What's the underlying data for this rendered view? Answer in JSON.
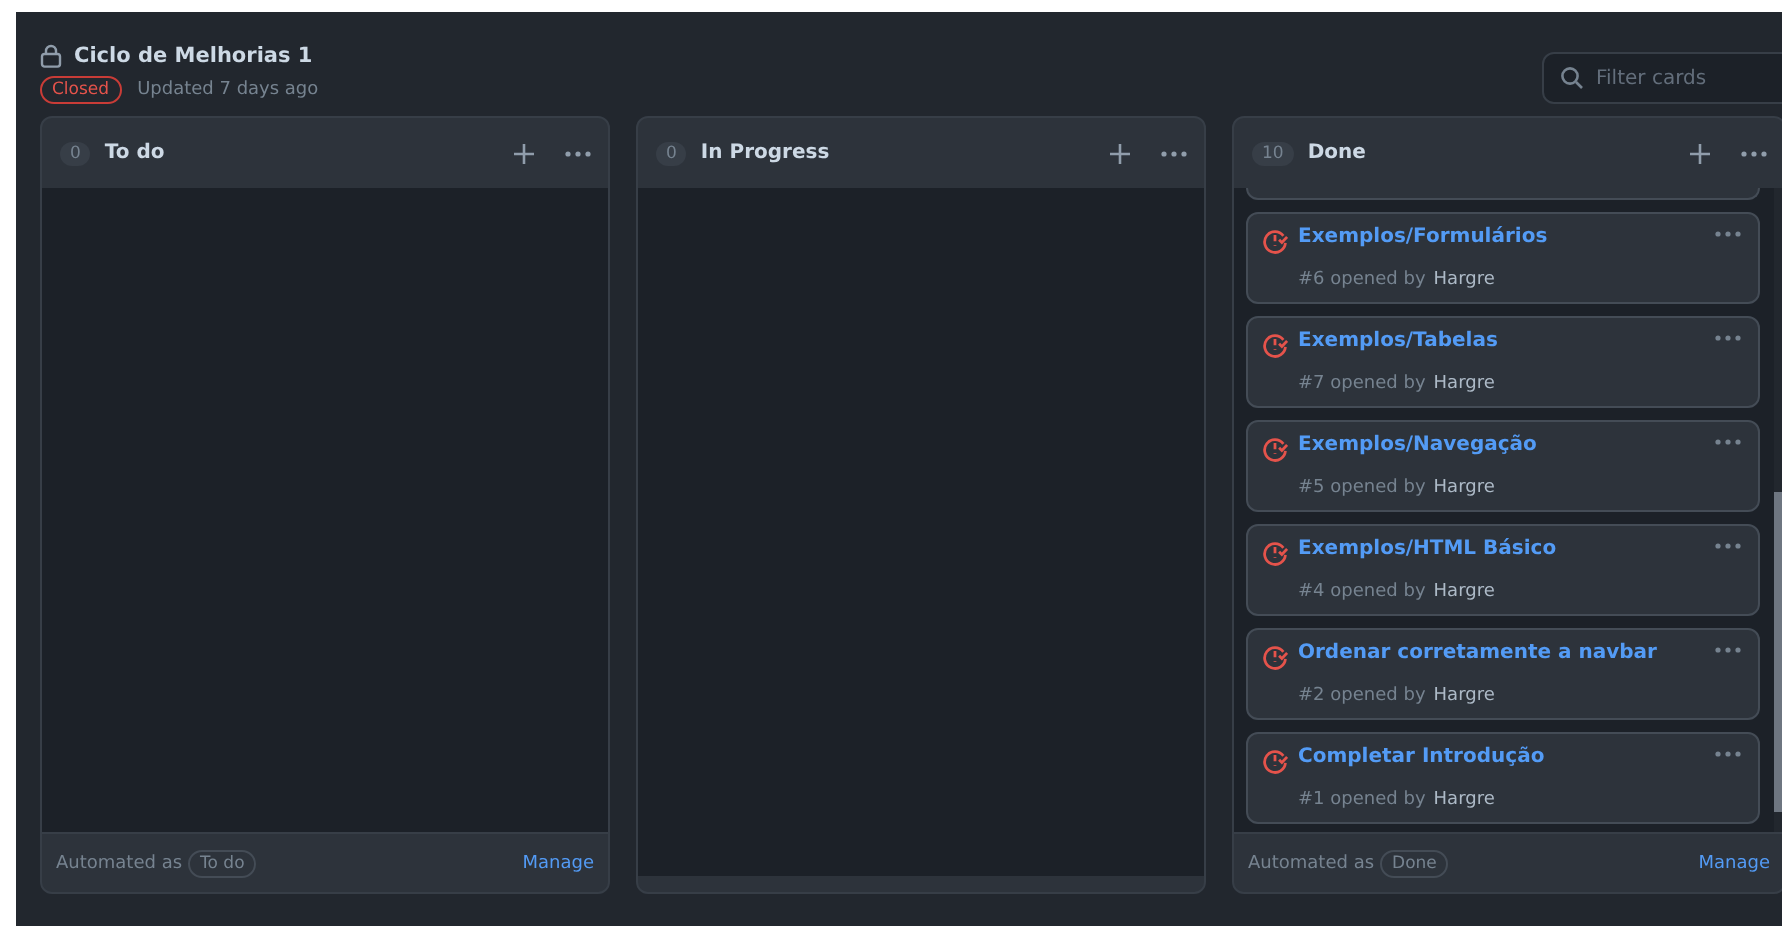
{
  "project": {
    "title": "Ciclo de Melhorias 1",
    "status": "Closed",
    "updated": "Updated 7 days ago"
  },
  "search": {
    "placeholder": "Filter cards"
  },
  "columns": [
    {
      "count": "0",
      "name": "To do",
      "automated_label": "Automated as",
      "automation": "To do",
      "manage": "Manage"
    },
    {
      "count": "0",
      "name": "In Progress"
    },
    {
      "count": "10",
      "name": "Done",
      "automated_label": "Automated as",
      "automation": "Done",
      "manage": "Manage",
      "cards": [
        {
          "title": "Exemplos/Formulários",
          "number": "#6",
          "opened": "opened by",
          "author": "Hargre"
        },
        {
          "title": "Exemplos/Tabelas",
          "number": "#7",
          "opened": "opened by",
          "author": "Hargre"
        },
        {
          "title": "Exemplos/Navegação",
          "number": "#5",
          "opened": "opened by",
          "author": "Hargre"
        },
        {
          "title": "Exemplos/HTML Básico",
          "number": "#4",
          "opened": "opened by",
          "author": "Hargre"
        },
        {
          "title": "Ordenar corretamente a navbar",
          "number": "#2",
          "opened": "opened by",
          "author": "Hargre"
        },
        {
          "title": "Completar Introdução",
          "number": "#1",
          "opened": "opened by",
          "author": "Hargre"
        }
      ]
    }
  ]
}
